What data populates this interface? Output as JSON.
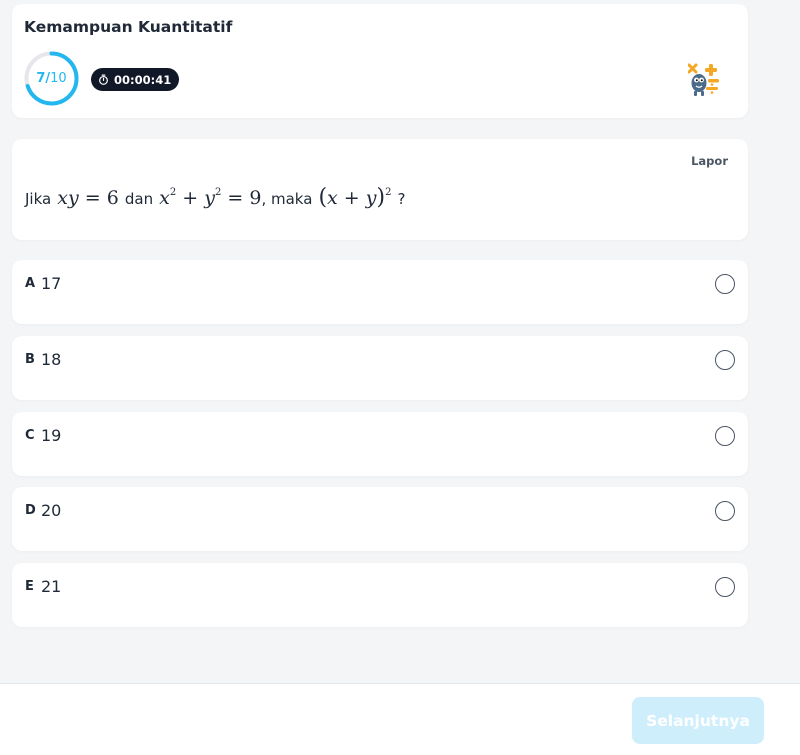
{
  "header": {
    "title": "Kemampuan Kuantitatif",
    "progress": {
      "current": "7",
      "separator": "/",
      "total": "10",
      "fraction": 0.7
    },
    "timer": "00:00:41",
    "accent_color": "#22b7ef"
  },
  "question": {
    "report_label": "Lapor",
    "prefix": "Jika",
    "conn1": "dan",
    "conn2": "maka",
    "suffix": "?"
  },
  "options": [
    {
      "letter": "A",
      "text": "17"
    },
    {
      "letter": "B",
      "text": "18"
    },
    {
      "letter": "C",
      "text": "19"
    },
    {
      "letter": "D",
      "text": "20"
    },
    {
      "letter": "E",
      "text": "21"
    }
  ],
  "footer": {
    "next_label": "Selanjutnya",
    "next_color": "#cfeefc"
  }
}
